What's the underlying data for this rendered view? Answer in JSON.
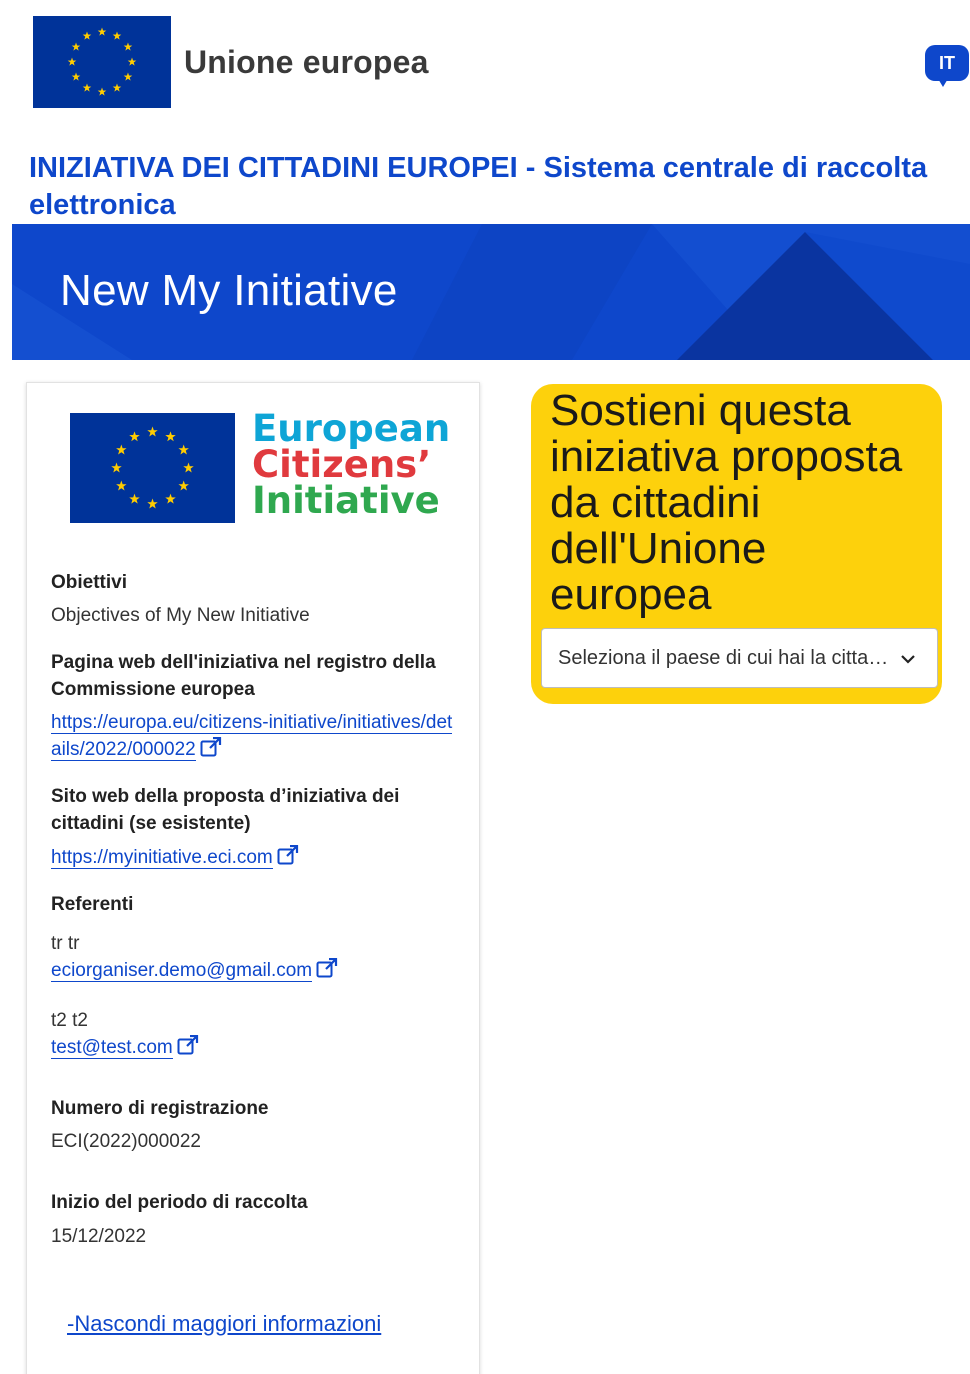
{
  "header": {
    "site_name": "Unione europea",
    "language_code": "IT",
    "portal_title": "INIZIATIVA DEI CITTADINI EUROPEI - Sistema centrale di raccolta elettronica"
  },
  "banner": {
    "title": "New My Initiative"
  },
  "logo": {
    "line1": "European",
    "line2": "Citizens’",
    "line3": "Initiative"
  },
  "details": {
    "objectives_label": "Obiettivi",
    "objectives_value": "Objectives of My New Initiative",
    "register_label": "Pagina web dell'iniziativa nel registro della Commissione europea",
    "register_url": "https://europa.eu/citizens-initiative/initiatives/details/2022/000022",
    "website_label": "Sito web della proposta d’iniziativa dei cittadini (se esistente)",
    "website_url": "https://myinitiative.eci.com",
    "contacts_label": "Referenti",
    "contacts": [
      {
        "name": "tr tr",
        "email": "eciorganiser.demo@gmail.com"
      },
      {
        "name": "t2 t2",
        "email": "test@test.com"
      }
    ],
    "registration_label": "Numero di registrazione",
    "registration_value": "ECI(2022)000022",
    "collection_start_label": "Inizio del periodo di raccolta",
    "collection_start_value": "15/12/2022",
    "toggle_link": "-Nascondi maggiori informazioni"
  },
  "support": {
    "title": "Sostieni questa iniziativa proposta da cittadini dell'Unione europea",
    "country_select_placeholder": "Seleziona il paese di cui hai la cittadinanza"
  },
  "colors": {
    "primary_blue": "#0e47cb",
    "eu_flag_blue": "#003399",
    "eu_star_yellow": "#ffcc00",
    "support_yellow": "#fdd10c",
    "logo_blue": "#0ea5d6",
    "logo_red": "#e03a3e",
    "logo_green": "#2fa84f"
  },
  "icons": {
    "external_link": "external-link-icon",
    "dropdown": "chevron-down-icon",
    "language": "speech-bubble-icon"
  }
}
